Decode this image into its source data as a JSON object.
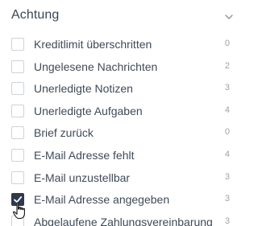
{
  "header": {
    "title": "Achtung",
    "toggle_icon": "chevron-down-icon"
  },
  "items": [
    {
      "label": "Kreditlimit überschritten",
      "count": "0",
      "checked": false
    },
    {
      "label": "Ungelesene Nachrichten",
      "count": "2",
      "checked": false
    },
    {
      "label": "Unerledigte Notizen",
      "count": "3",
      "checked": false
    },
    {
      "label": "Unerledigte Aufgaben",
      "count": "4",
      "checked": false
    },
    {
      "label": "Brief zurück",
      "count": "0",
      "checked": false
    },
    {
      "label": "E-Mail Adresse fehlt",
      "count": "4",
      "checked": false
    },
    {
      "label": "E-Mail unzustellbar",
      "count": "3",
      "checked": false
    },
    {
      "label": "E-Mail Adresse angegeben",
      "count": "3",
      "checked": true
    },
    {
      "label": "Abgelaufene Zahlungsvereinbarung",
      "count": "3",
      "checked": false
    }
  ],
  "colors": {
    "checked_fill": "#2d3a4b",
    "label_text": "#3f4a57",
    "count_text": "#9aa3ad"
  }
}
